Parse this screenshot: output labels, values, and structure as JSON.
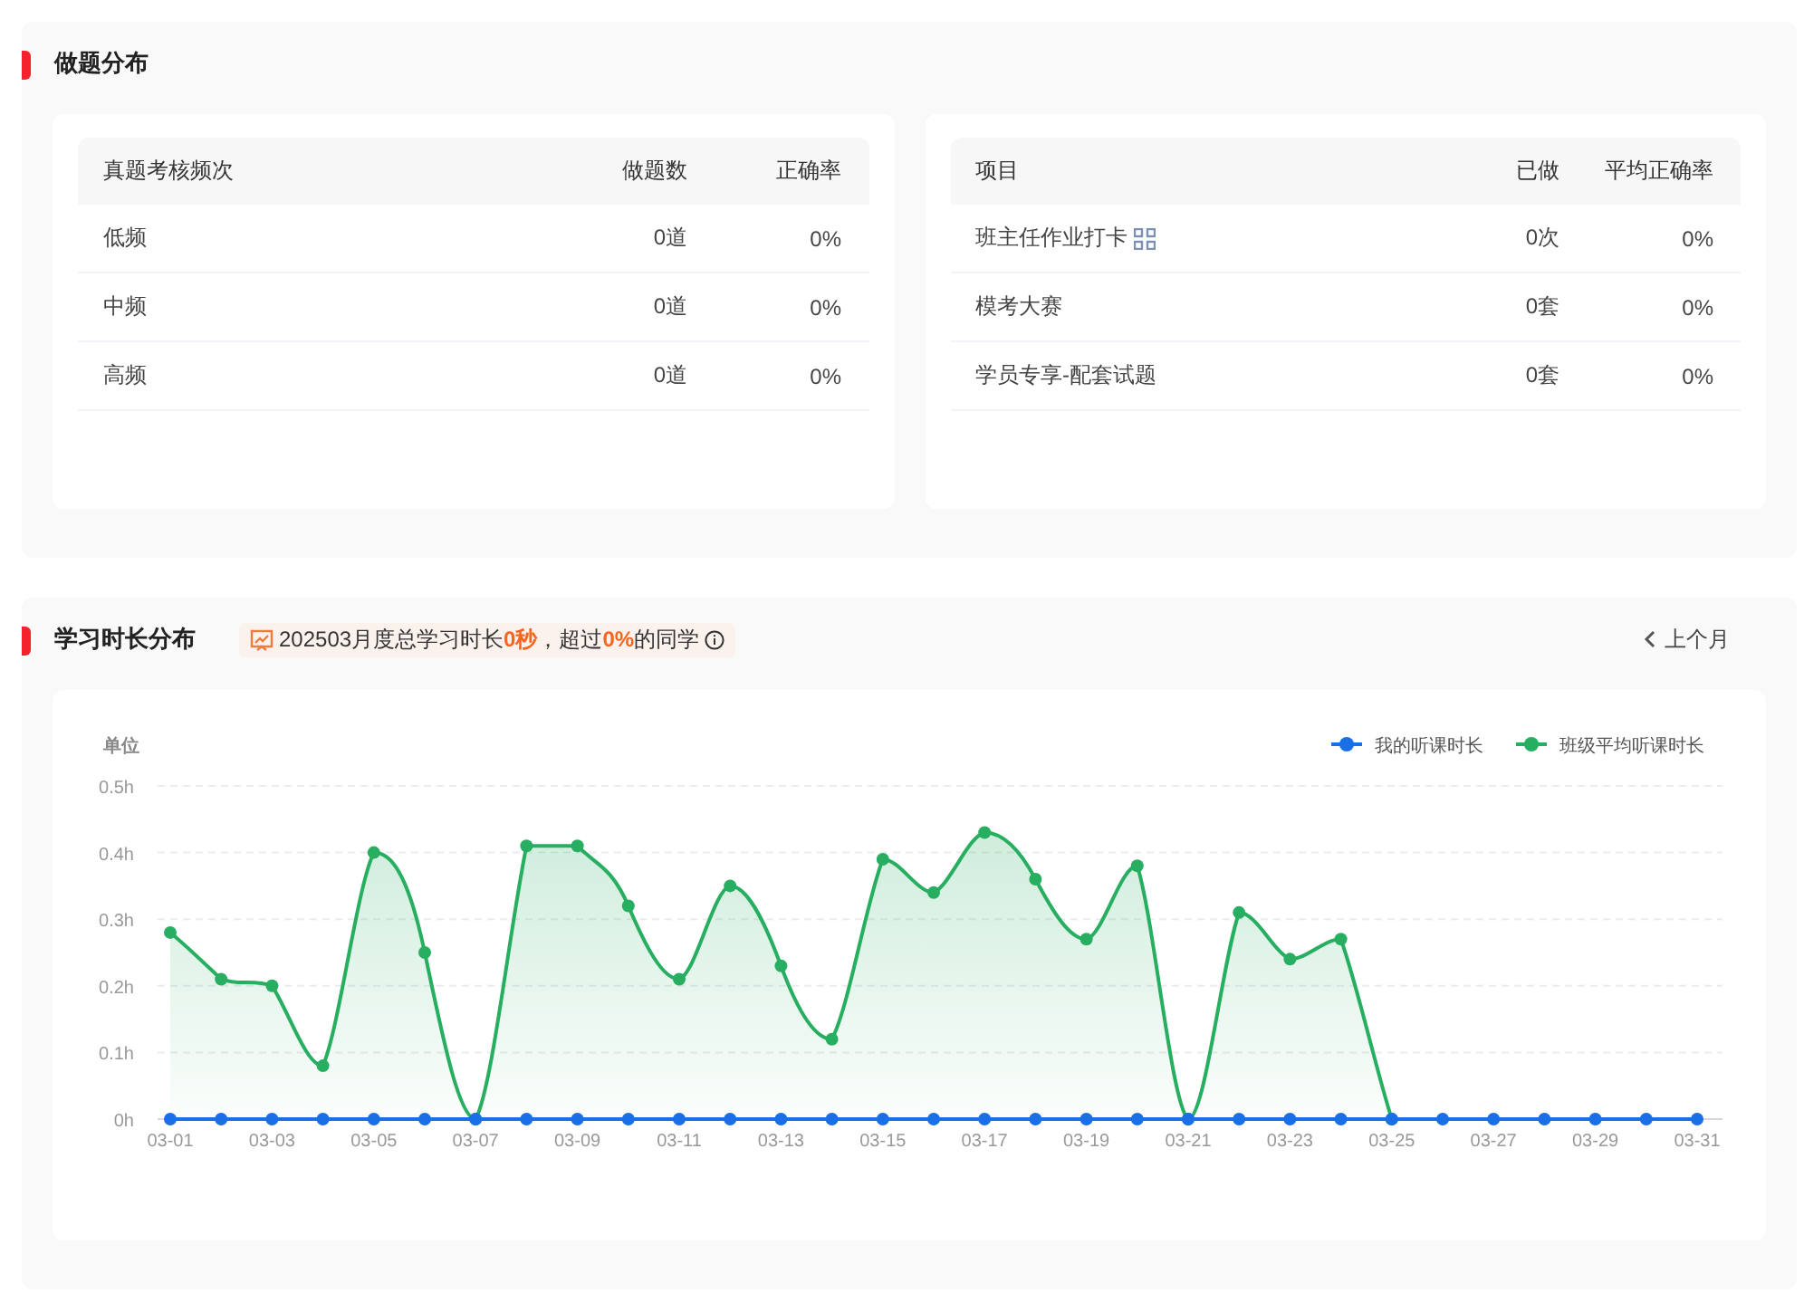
{
  "practice": {
    "title": "做题分布",
    "frequency_table": {
      "columns": [
        "真题考核频次",
        "做题数",
        "正确率"
      ],
      "rows": [
        {
          "cells": [
            "低频",
            "0道",
            "0%"
          ],
          "has_icon": false
        },
        {
          "cells": [
            "中频",
            "0道",
            "0%"
          ],
          "has_icon": false
        },
        {
          "cells": [
            "高频",
            "0道",
            "0%"
          ],
          "has_icon": false
        }
      ]
    },
    "project_table": {
      "columns": [
        "项目",
        "已做",
        "平均正确率"
      ],
      "rows": [
        {
          "cells": [
            "班主任作业打卡",
            "0次",
            "0%"
          ],
          "has_icon": true
        },
        {
          "cells": [
            "模考大赛",
            "0套",
            "0%"
          ],
          "has_icon": false
        },
        {
          "cells": [
            "学员专享-配套试题",
            "0套",
            "0%"
          ],
          "has_icon": false
        }
      ]
    }
  },
  "study_time": {
    "title": "学习时长分布",
    "summary": "202503月度总学习时长**0秒**，超过**0%**的同学",
    "prev_month": "上个月",
    "chart_data": {
      "type": "area",
      "ylabel": "单位",
      "grid": true,
      "legend": true,
      "categories": [
        "03-01",
        null,
        "03-03",
        null,
        "03-05",
        null,
        "03-07",
        null,
        "03-09",
        null,
        "03-11",
        null,
        "03-13",
        null,
        "03-15",
        null,
        "03-17",
        null,
        "03-19",
        null,
        "03-21",
        null,
        "03-23",
        null,
        "03-25",
        null,
        "03-27",
        null,
        "03-29",
        null,
        "03-31"
      ],
      "ylim": [
        0,
        0.5
      ],
      "yticks": [
        {
          "value": 0,
          "label": "0h"
        },
        {
          "value": 0.1,
          "label": "0.1h"
        },
        {
          "value": 0.2,
          "label": "0.2h"
        },
        {
          "value": 0.3,
          "label": "0.3h"
        },
        {
          "value": 0.4,
          "label": "0.4h"
        },
        {
          "value": 0.5,
          "label": "0.5h"
        }
      ],
      "series": [
        {
          "name": "我的听课时长",
          "color": "#1a6fe6",
          "marker": "circle",
          "type": "line",
          "values": [
            0,
            0,
            0,
            0,
            0,
            0,
            0,
            0,
            0,
            0,
            0,
            0,
            0,
            0,
            0,
            0,
            0,
            0,
            0,
            0,
            0,
            0,
            0,
            0,
            0,
            0,
            0,
            0,
            0,
            0,
            0
          ]
        },
        {
          "name": "班级平均听课时长",
          "color": "#27ae60",
          "marker": "circle",
          "values": [
            0.28,
            0.21,
            0.2,
            0.08,
            0.4,
            0.25,
            0,
            0.41,
            0.41,
            0.32,
            0.21,
            0.35,
            0.23,
            0.12,
            0.39,
            0.34,
            0.43,
            0.36,
            0.27,
            0.38,
            0,
            0.31,
            0.24,
            0.27,
            0,
            null,
            null,
            null,
            null,
            null,
            null
          ]
        }
      ]
    }
  }
}
